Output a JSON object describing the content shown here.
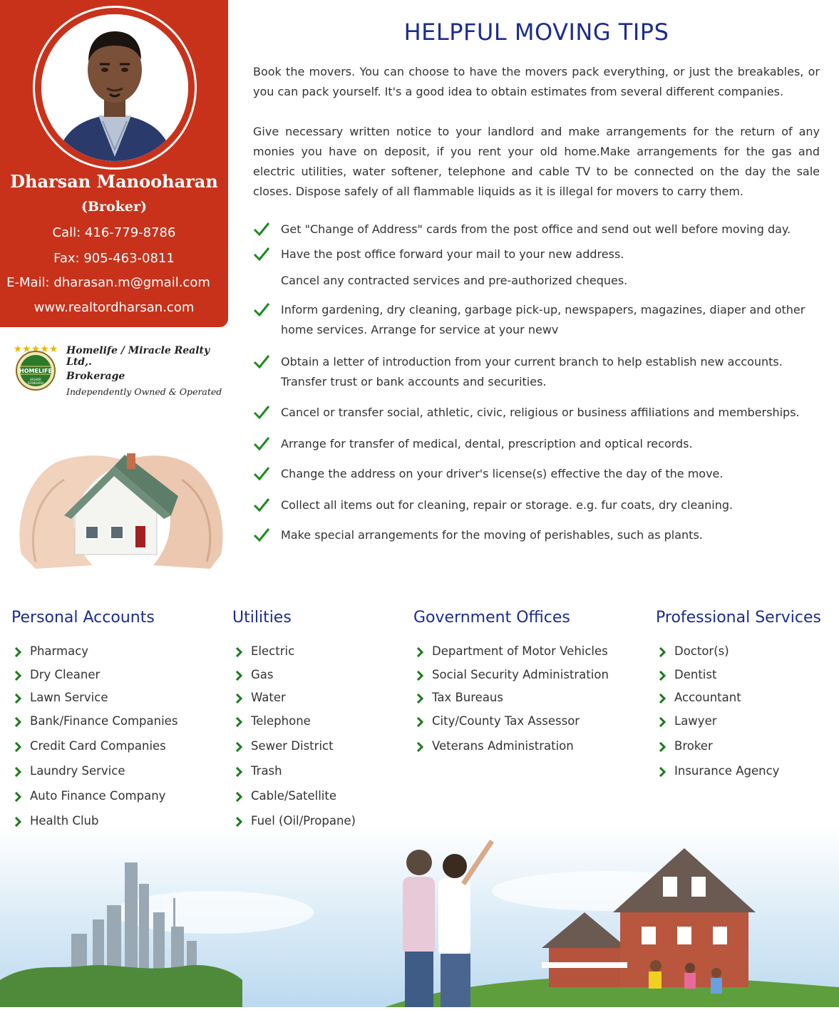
{
  "agent": {
    "name": "Dharsan Manooharan",
    "role": "(Broker)",
    "call": "Call: 416-779-8786",
    "fax": "Fax: 905-463-0811",
    "email": "E-Mail: dharasan.m@gmail.com",
    "website": "www.realtordharsan.com"
  },
  "brokerage": {
    "line1": "Homelife / Miracle Realty Ltd,.",
    "line2": "Brokerage",
    "line3": "Independently Owned & Operated",
    "logo_text": "HOMELIFE",
    "logo_subtext": "HIGHER STANDARD"
  },
  "main": {
    "title": "HELPFUL MOVING TIPS",
    "paragraphs": [
      "Book the movers. You can choose to have the movers pack everything, or just the breakables, or you can pack yourself. It's a good idea to obtain estimates from several different companies.",
      "Give necessary written notice to your landlord and make arrangements for the return of any monies you have on deposit, if you rent your old home.Make arrangements for the gas and electric utilities, water softener, telephone and cable TV to be connected on the day the sale closes. Dispose safely of all flammable liquids as it is illegal for movers to carry them."
    ],
    "tips": [
      "Get \"Change of Address\" cards from the post office and send out well before moving day.",
      "Have the post office forward your mail to your new address.",
      "Cancel any contracted services and pre-authorized cheques.",
      "Inform gardening, dry cleaning, garbage pick-up, newspapers, magazines, diaper and other home services. Arrange for service at your newv",
      "Obtain a letter of introduction from your current branch to help establish new accounts. Transfer trust or bank accounts and securities.",
      "Cancel or transfer social, athletic, civic, religious or business affiliations and memberships.",
      "Arrange for transfer of medical, dental, prescription and optical records.",
      "Change the address on your driver's license(s) effective the day of the move.",
      "Collect all items out for cleaning, repair or storage. e.g. fur coats, dry cleaning.",
      "Make special arrangements for the moving of perishables, such as plants."
    ]
  },
  "directory": [
    {
      "title": "Personal Accounts",
      "items": [
        "Pharmacy",
        "Dry Cleaner",
        "Lawn Service",
        "Bank/Finance Companies",
        "Credit Card Companies",
        "Laundry Service",
        "Auto Finance Company",
        "Health Club"
      ]
    },
    {
      "title": "Utilities",
      "items": [
        "Electric",
        "Gas",
        "Water",
        "Telephone",
        "Sewer District",
        "Trash",
        "Cable/Satellite",
        "Fuel (Oil/Propane)"
      ]
    },
    {
      "title": "Government Offices",
      "items": [
        "Department of Motor Vehicles",
        "Social Security Administration",
        "Tax Bureaus",
        "City/County Tax Assessor",
        "Veterans Administration"
      ]
    },
    {
      "title": "Professional Services",
      "items": [
        "Doctor(s)",
        "Dentist",
        "Accountant",
        "Lawyer",
        "Broker",
        "Insurance Agency"
      ]
    }
  ],
  "colors": {
    "sidebar_red": "#c8321b",
    "heading_blue": "#1b2d8f",
    "check_green": "#1e8a1e",
    "chevron_green": "#1a7a1a"
  },
  "icons": {
    "tip_bullet": "checkmark-icon",
    "directory_bullet": "chevron-right-icon"
  }
}
